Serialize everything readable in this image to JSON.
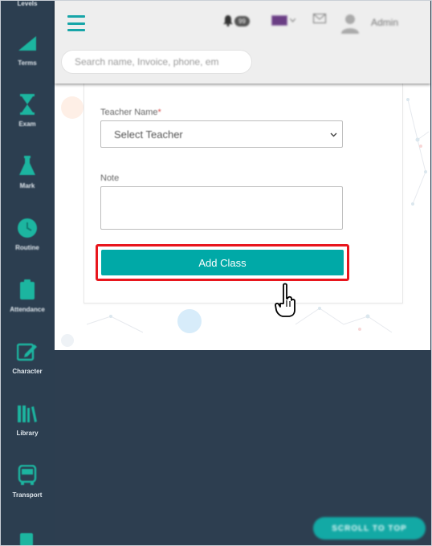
{
  "sidebar": {
    "top_label": "Levels",
    "items": [
      {
        "label": "Terms",
        "icon": "signal-bars-icon"
      },
      {
        "label": "Exam",
        "icon": "hourglass-icon"
      },
      {
        "label": "Mark",
        "icon": "flask-icon"
      },
      {
        "label": "Routine",
        "icon": "clock-icon"
      },
      {
        "label": "Attendance",
        "icon": "clipboard-icon"
      },
      {
        "label": "Character",
        "icon": "edit-square-icon"
      },
      {
        "label": "Library",
        "icon": "books-icon"
      },
      {
        "label": "Transport",
        "icon": "bus-icon"
      }
    ]
  },
  "topbar": {
    "notification_count": "99",
    "user_name": "Admin"
  },
  "search": {
    "placeholder": "Search name, Invoice, phone, em"
  },
  "form": {
    "teacher_label": "Teacher Name",
    "required_mark": "*",
    "teacher_select_value": "Select Teacher",
    "note_label": "Note",
    "note_value": "",
    "submit_label": "Add Class"
  },
  "scroll_top": {
    "label": "SCROLL TO TOP"
  },
  "colors": {
    "sidebar": "#2c3e50",
    "accent": "#00a9a7",
    "highlight": "#e8161d"
  }
}
